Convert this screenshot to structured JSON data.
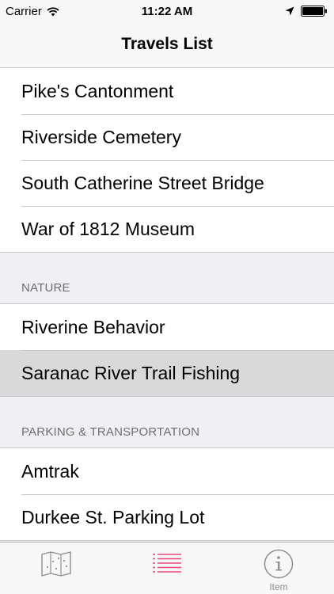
{
  "status_bar": {
    "carrier": "Carrier",
    "time": "11:22 AM"
  },
  "nav": {
    "title": "Travels List"
  },
  "sections": [
    {
      "header": "",
      "rows": [
        "Pike's Cantonment",
        "Riverside Cemetery",
        "South Catherine Street Bridge",
        "War of 1812 Museum"
      ]
    },
    {
      "header": "NATURE",
      "rows": [
        "Riverine Behavior",
        "Saranac River Trail Fishing"
      ],
      "selected": 1
    },
    {
      "header": "PARKING & TRANSPORTATION",
      "rows": [
        "Amtrak",
        "Durkee St. Parking Lot"
      ]
    }
  ],
  "tab_bar": {
    "tabs": [
      {
        "icon": "map-icon",
        "label": ""
      },
      {
        "icon": "list-icon",
        "label": "",
        "active": true
      },
      {
        "icon": "info-icon",
        "label": "Item"
      }
    ],
    "active_color": "#e8497c",
    "inactive_color": "#8e8e93"
  }
}
